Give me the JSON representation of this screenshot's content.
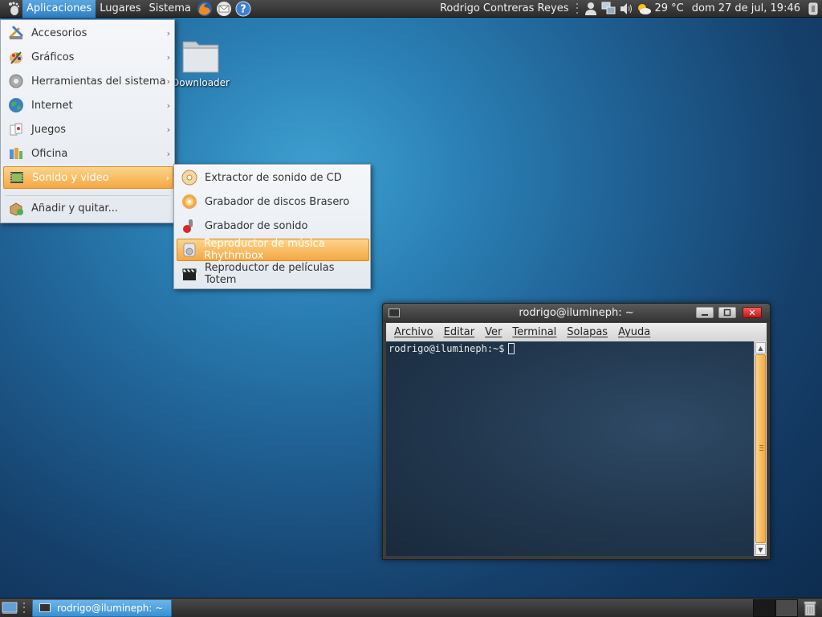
{
  "top_panel": {
    "menus": [
      "Aplicaciones",
      "Lugares",
      "Sistema"
    ],
    "user_name": "Rodrigo Contreras Reyes",
    "temperature": "29 °C",
    "datetime": "dom 27 de jul, 19:46"
  },
  "desktop": {
    "folder_label": "Downloader"
  },
  "app_menu": {
    "items": [
      {
        "label": "Accesorios",
        "icon": "accessories-icon"
      },
      {
        "label": "Gráficos",
        "icon": "graphics-icon"
      },
      {
        "label": "Herramientas del sistema",
        "icon": "system-tools-icon"
      },
      {
        "label": "Internet",
        "icon": "internet-globe-icon"
      },
      {
        "label": "Juegos",
        "icon": "games-icon"
      },
      {
        "label": "Oficina",
        "icon": "office-icon"
      },
      {
        "label": "Sonido y video",
        "icon": "sound-video-icon"
      }
    ],
    "add_remove": "Añadir y quitar..."
  },
  "sub_menu": {
    "items": [
      {
        "label": "Extractor de sonido de CD",
        "icon": "cd-extractor-icon"
      },
      {
        "label": "Grabador de discos Brasero",
        "icon": "brasero-icon"
      },
      {
        "label": "Grabador de sonido",
        "icon": "sound-recorder-icon"
      },
      {
        "label": "Reproductor de música Rhythmbox",
        "icon": "rhythmbox-icon"
      },
      {
        "label": "Reproductor de películas Totem",
        "icon": "totem-clapper-icon"
      }
    ]
  },
  "terminal": {
    "title": "rodrigo@ilumineph: ~",
    "menubar": [
      "Archivo",
      "Editar",
      "Ver",
      "Terminal",
      "Solapas",
      "Ayuda"
    ],
    "prompt": "rodrigo@ilumineph:~$"
  },
  "bottom_panel": {
    "task_label": "rodrigo@ilumineph: ~"
  },
  "colors": {
    "highlight": "#f4a842",
    "panel": "#2b2b2b",
    "active_menu": "#2f7fc4"
  }
}
